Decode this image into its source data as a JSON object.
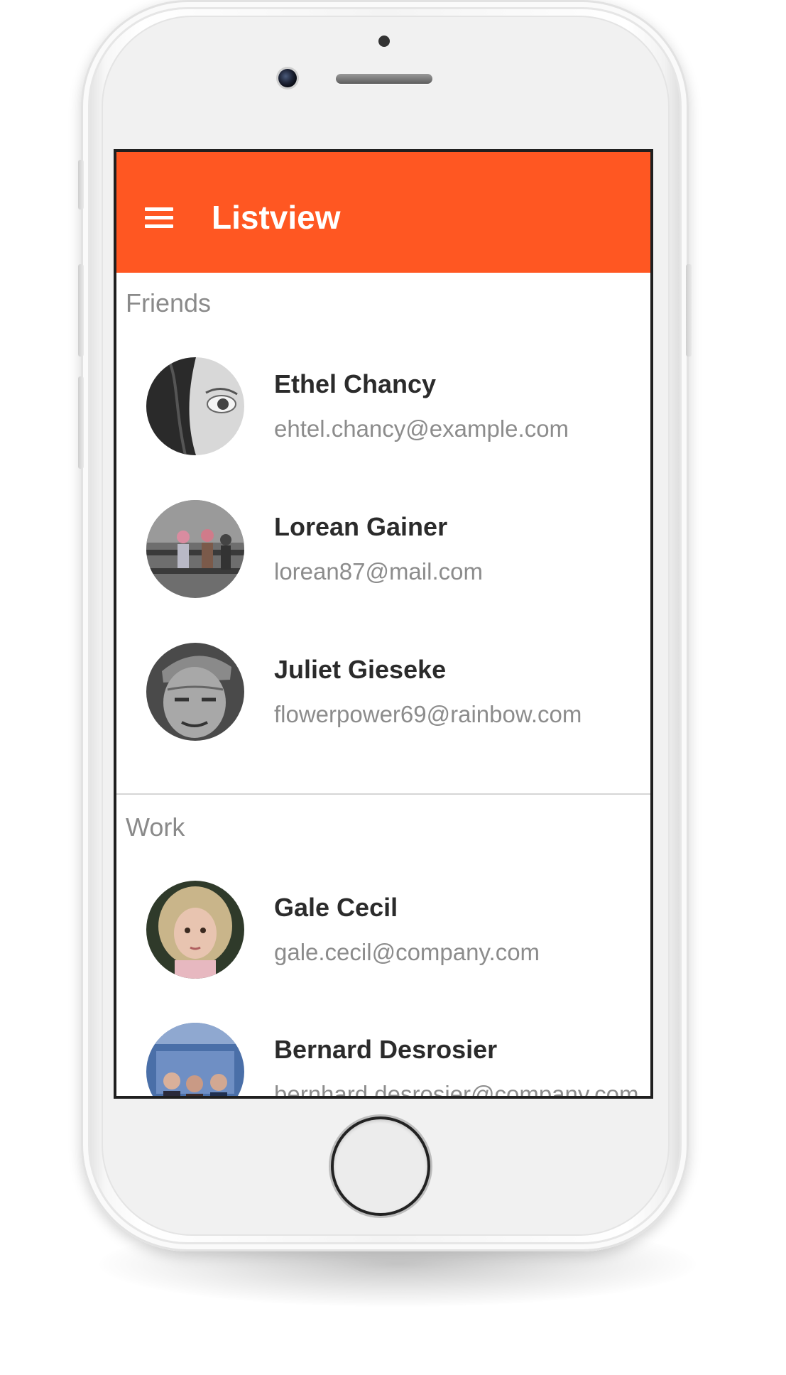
{
  "app_bar": {
    "title": "Listview",
    "menu_icon": "hamburger-menu-icon",
    "color": "#ff5722"
  },
  "sections": [
    {
      "header": "Friends",
      "items": [
        {
          "name": "Ethel Chancy",
          "email": "ehtel.chancy@example.com"
        },
        {
          "name": "Lorean Gainer",
          "email": "lorean87@mail.com"
        },
        {
          "name": "Juliet Gieseke",
          "email": "flowerpower69@rainbow.com"
        }
      ]
    },
    {
      "header": "Work",
      "items": [
        {
          "name": "Gale Cecil",
          "email": "gale.cecil@company.com"
        },
        {
          "name": "Bernard Desrosier",
          "email": "bernhard.desrosier@company.com"
        }
      ]
    }
  ]
}
